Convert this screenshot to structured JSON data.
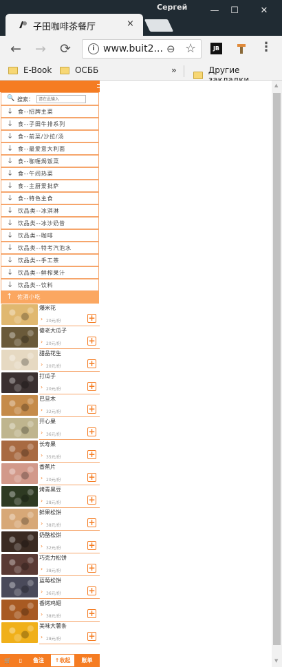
{
  "window": {
    "user": "Сергей",
    "controls": [
      "—",
      "☐",
      "✕"
    ]
  },
  "tab": {
    "title": "子田咖啡茶餐厅",
    "close": "×"
  },
  "nav": {
    "back": "←",
    "forward": "→",
    "reload": "⟳",
    "url": "www.buit2...",
    "info": "i",
    "zoom": "⊖",
    "star": "☆",
    "ext_label": "JB",
    "menu": "⋮"
  },
  "bookmarks": {
    "items": [
      "E-Book",
      "ОСББ"
    ],
    "more": "»",
    "other": "Другие закладки"
  },
  "search": {
    "label": "搜索：",
    "placeholder": "请在此输入"
  },
  "categories": [
    "食--招牌主菜",
    "食--子田牛排系列",
    "食--前菜/沙拉/汤",
    "食--最爱意大利面",
    "食--咖喱焗饭菜",
    "食--午间热菜",
    "食--主厨爱批萨",
    "食--特色主食",
    "饮品类--冰淇淋",
    "饮品类--冰沙奶昔",
    "饮品类--咖啡",
    "饮品类--特考汽泡水",
    "饮品类--手工茶",
    "饮品类--鲜榨果汁",
    "饮品类--饮料"
  ],
  "active_category": "佐酒小吃",
  "products": [
    {
      "name": "爆米花",
      "price": "20元/份",
      "color": "#e0b870"
    },
    {
      "name": "傻老大瓜子",
      "price": "20元/份",
      "color": "#6a5a3a"
    },
    {
      "name": "甜品花生",
      "price": "20元/份",
      "color": "#e6d9c2"
    },
    {
      "name": "打瓜子",
      "price": "20元/份",
      "color": "#3a3030"
    },
    {
      "name": "巴旦木",
      "price": "32元/份",
      "color": "#c58b4a"
    },
    {
      "name": "开心果",
      "price": "36元/份",
      "color": "#bfb58e"
    },
    {
      "name": "长寿果",
      "price": "35元/份",
      "color": "#a86a42"
    },
    {
      "name": "香蕉片",
      "price": "20元/份",
      "color": "#d2998a"
    },
    {
      "name": "烤青黑豆",
      "price": "28元/份",
      "color": "#2e3a22"
    },
    {
      "name": "鲜果松饼",
      "price": "38元/份",
      "color": "#d7a877"
    },
    {
      "name": "奶酪松饼",
      "price": "32元/份",
      "color": "#3b2b22"
    },
    {
      "name": "巧克力松饼",
      "price": "38元/份",
      "color": "#5a3a34"
    },
    {
      "name": "蓝莓松饼",
      "price": "36元/份",
      "color": "#4a4a5a"
    },
    {
      "name": "香烤鸡翅",
      "price": "38元/份",
      "color": "#a85a22"
    },
    {
      "name": "美味大薯条",
      "price": "28元/份",
      "color": "#f0b01a"
    }
  ],
  "bottombar": {
    "cart_icon": "🛒",
    "note": "备注",
    "collect": "收起",
    "bill": "账单"
  },
  "colors": {
    "accent": "#f57c22",
    "light": "#fba761",
    "border": "#f6a56b"
  }
}
